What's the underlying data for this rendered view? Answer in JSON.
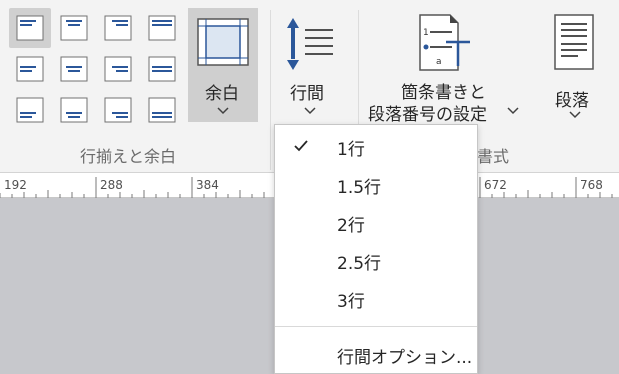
{
  "ribbon": {
    "margins_label": "余白",
    "line_spacing_label": "行間",
    "bullets_label_line1": "箇条書きと",
    "bullets_label_line2": "段落番号の設定",
    "paragraph_label": "段落",
    "group_align_label": "行揃えと余白",
    "group_format_label_partial": "書式"
  },
  "ruler": {
    "ticks": [
      "192",
      "288",
      "384",
      "672",
      "768"
    ]
  },
  "line_spacing_menu": {
    "items": [
      {
        "label": "1行",
        "checked": true
      },
      {
        "label": "1.5行",
        "checked": false
      },
      {
        "label": "2行",
        "checked": false
      },
      {
        "label": "2.5行",
        "checked": false
      },
      {
        "label": "3行",
        "checked": false
      }
    ],
    "options_label": "行間オプション..."
  },
  "colors": {
    "accent_blue": "#2b579a",
    "selected_bg": "#cfcfcf",
    "ribbon_bg": "#f3f3f3",
    "doc_bg": "#c7c8cc"
  }
}
